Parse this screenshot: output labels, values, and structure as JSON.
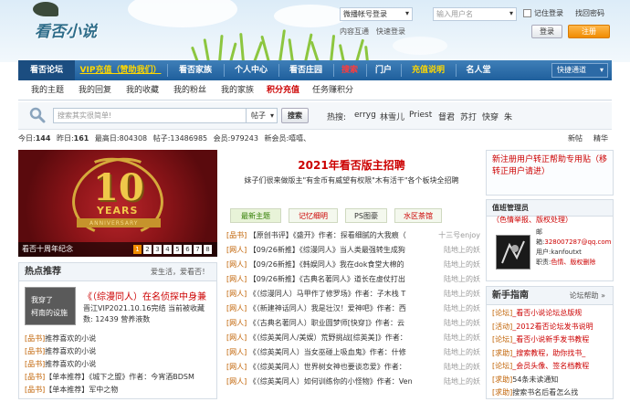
{
  "header": {
    "logo_text": "看否小说",
    "login_select": "微播帐号登录",
    "username_placeholder": "输入用户名",
    "remember_label": "记住登录",
    "find_password": "找回密码",
    "neirong_link": "内容互通",
    "quick_login": "快速登录",
    "login_button": "登录",
    "register_button": "注册"
  },
  "nav": {
    "items": [
      "看否论坛",
      "VIP充值（赞助我们）",
      "看否家族",
      "个人中心",
      "看否庄园",
      "搜索",
      "门户",
      "充值说明",
      "名人堂"
    ],
    "quick_channel": "快捷通道"
  },
  "subnav": {
    "items": [
      "我的主题",
      "我的回复",
      "我的收藏",
      "我的粉丝",
      "我的家族",
      "积分充值",
      "任务赚积分"
    ]
  },
  "search": {
    "placeholder": "搜索其实很简单!",
    "type_select": "帖子",
    "button": "搜索",
    "hot_label": "热搜:",
    "hot_terms": [
      "erryg",
      "林雪儿",
      "Priest",
      "督君",
      "苏打",
      "快穿",
      "朱"
    ]
  },
  "stats": {
    "today_label": "今日:",
    "today": "144",
    "yesterday_label": "昨日:",
    "yesterday": "161",
    "max_label": "最高日:",
    "max": "804308",
    "posts_label": "帖子:",
    "posts": "13486985",
    "members_label": "会员:",
    "members": "979243",
    "newest_label": "新会员:",
    "newest": "嘻嘻、",
    "new_link": "新帖",
    "best_link": "精华"
  },
  "slider": {
    "caption": "看否十周年纪念",
    "ten": "10",
    "years": "YEARS",
    "anniversary": "ANNIVERSARY",
    "pages": [
      "1",
      "2",
      "3",
      "4",
      "5",
      "6",
      "7",
      "8"
    ],
    "active_page": 1
  },
  "hot": {
    "title": "热点推荐",
    "more": "爱生活，爱看否！",
    "thumb_line1": "我穿了",
    "thumb_line2": "柯南的设施",
    "feat_title": "《（综漫同人）在名侦探中身兼",
    "feat_line1": "晋江VIP2021.10.16完结 当前被收藏",
    "feat_line2": "数: 12439 营养液数",
    "list": [
      {
        "cat": "[品书]",
        "text": "推荐喜欢的小说"
      },
      {
        "cat": "[品书]",
        "text": "推荐喜欢的小说"
      },
      {
        "cat": "[品书]",
        "text": "推荐喜欢的小说"
      },
      {
        "cat": "[品书]",
        "text": "【单本推荐】《城下之盟》作者：今宵酒BDSM"
      },
      {
        "cat": "[品书]",
        "text": "【单本推荐】军中之物"
      }
    ]
  },
  "mid": {
    "title": "2021年看否版主招聘",
    "intro": "妹子们很来做版主\"有金币有威望有权限\"木有活干\"各个板块全招聘",
    "tabs": [
      "最新主题",
      "记忆细明",
      "PS图豪",
      "水区茶馆"
    ],
    "rows": [
      {
        "cat": "[品书]",
        "text": "【原创书评】《盛开》作者：探看细腻的大我痕（",
        "meta": "十三号enjoy"
      },
      {
        "cat": "[网人]",
        "text": "【09/26新推】《综漫同人》当人类最强转生成狗",
        "meta": "陆地上的妖"
      },
      {
        "cat": "[网人]",
        "text": "【09/26新推】《韩娱同人》我在dok食堂大棉的",
        "meta": "陆地上的妖"
      },
      {
        "cat": "[网人]",
        "text": "【09/26新推】《古典名著同人》道长在虚仗打出",
        "meta": "陆地上的妖"
      },
      {
        "cat": "[网人]",
        "text": "《（综漫同人）马甲作了修罗场》作者：子木栈 T",
        "meta": "陆地上的妖"
      },
      {
        "cat": "[网人]",
        "text": "《（新建神话同人）我是壮汉！爱神吧》作者：西",
        "meta": "陆地上的妖"
      },
      {
        "cat": "[网人]",
        "text": "《（古典名著同人）职业圆梦师[快穿]》作者：云",
        "meta": "陆地上的妖"
      },
      {
        "cat": "[网人]",
        "text": "《（综英美同人/美娱）荒野挑战[综英美]》作者：",
        "meta": "陆地上的妖"
      },
      {
        "cat": "[网人]",
        "text": "《（综英美同人）当女巫碰上吸血鬼》作者：什修",
        "meta": "陆地上的妖"
      },
      {
        "cat": "[网人]",
        "text": "《（综英美同人）世界树女神也要谈恋爱》作者：",
        "meta": "陆地上的妖"
      },
      {
        "cat": "[网人]",
        "text": "《（综英美同人）如何训练你的小怪物》作者：Ven",
        "meta": "陆地上的妖"
      }
    ]
  },
  "right1": {
    "text": "新注册用户转正帮助专用贴（移转正用户请进）"
  },
  "right2": {
    "header_label": "值班管理员",
    "header_note": "（色情举报、版权处理）",
    "email_label": "邮箱:",
    "email": "328007287@qq.com",
    "user_label": "用户:",
    "user": "kanfoutxt",
    "duty_label": "职责:",
    "duty": "色情、版权删除"
  },
  "right3": {
    "title": "新手指南",
    "more": "论坛帮助 »",
    "list": [
      {
        "cat": "[论坛]",
        "text": "_看否小说论坛总版规"
      },
      {
        "cat": "[活动]",
        "text": "_2012看否论坛发书说明"
      },
      {
        "cat": "[论坛]",
        "text": "_看否小说新手发书教程"
      },
      {
        "cat": "[求助]",
        "text": "_搜索教程，助你找书_"
      },
      {
        "cat": "[论坛]",
        "text": "_会员头像、签名档教程"
      },
      {
        "cat": "[求助]",
        "text": "54条未读通知"
      },
      {
        "cat": "[求助]",
        "text": "搜索书名后看怎么找"
      }
    ]
  }
}
